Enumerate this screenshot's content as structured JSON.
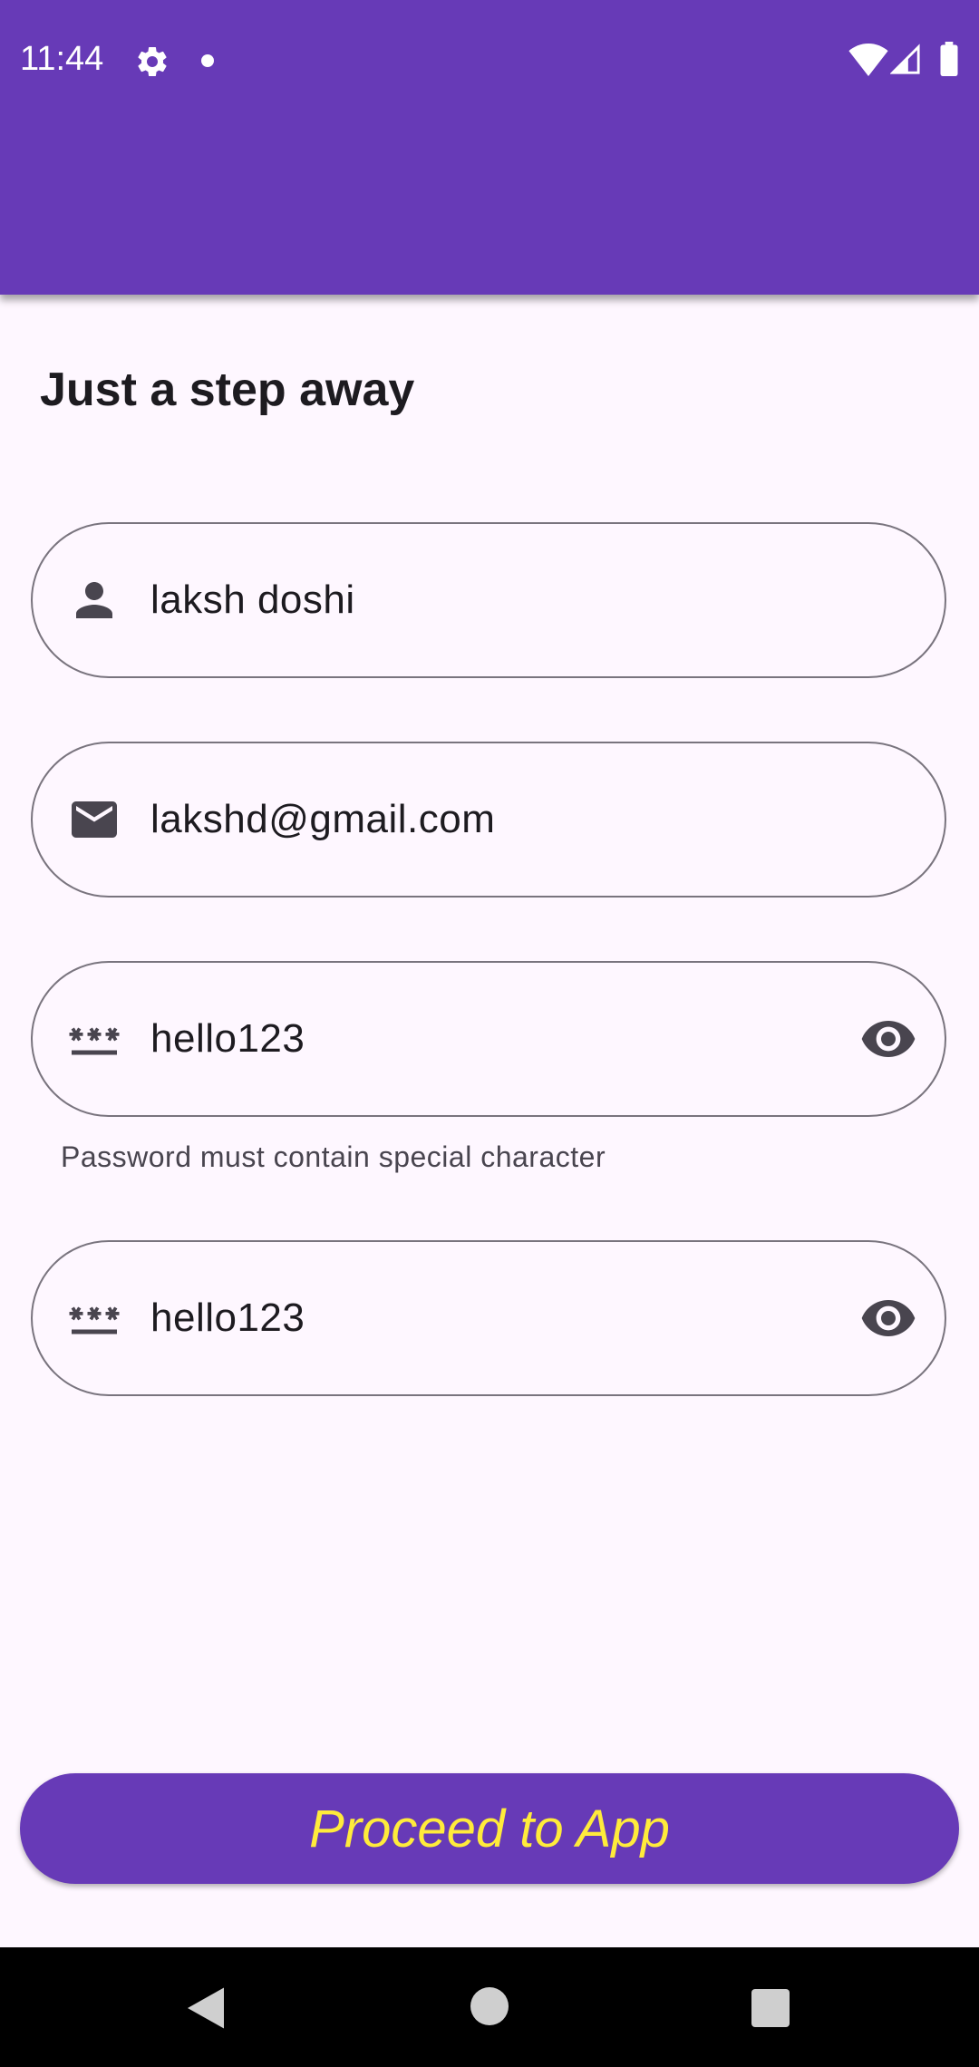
{
  "status_bar": {
    "time": "11:44"
  },
  "page": {
    "title": "Just a step away"
  },
  "form": {
    "name_value": "laksh doshi",
    "email_value": "lakshd@gmail.com",
    "password_value": "hello123",
    "password_helper": "Password must contain special character",
    "confirm_password_value": "hello123"
  },
  "actions": {
    "proceed_label": "Proceed to App"
  },
  "icons": {
    "name": "person-icon",
    "email": "mail-icon",
    "password": "password-icon",
    "visibility": "eye-icon"
  },
  "colors": {
    "primary": "#673ab7",
    "button_text": "#ffeb3b",
    "background": "#fef7ff",
    "outline": "#79747e"
  }
}
